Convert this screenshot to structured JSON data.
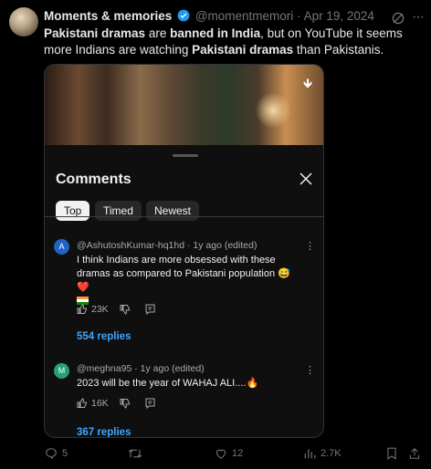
{
  "tweet": {
    "author_name": "Moments & memories",
    "handle": "@momentmemori",
    "date": "Apr 19, 2024",
    "text_parts": {
      "p1": "Pakistani dramas",
      "p2": " are ",
      "p3": "banned in India",
      "p4": ", but on YouTube it seems more Indians are watching ",
      "p5": "Pakistani dramas",
      "p6": " than Pakistanis."
    }
  },
  "media": {
    "panel_title": "Comments",
    "tabs": [
      "Top",
      "Timed",
      "Newest"
    ],
    "active_tab": "Top",
    "comments": [
      {
        "avatar_letter": "A",
        "avatar_color": "#1e63c7",
        "author": "@AshutoshKumar-hq1hd",
        "meta": "· 1y ago (edited)",
        "text": "I think Indians are more obsessed with these dramas as compared to Pakistani population 😅 ❤️",
        "likes": "23K",
        "replies": "554 replies"
      },
      {
        "avatar_letter": "M",
        "avatar_color": "#24a17a",
        "author": "@meghna95",
        "meta": "· 1y ago (edited)",
        "text": "2023 will be the year of WAHAJ ALI....🔥",
        "likes": "16K",
        "replies": "367 replies"
      }
    ]
  },
  "footer": {
    "replies": "5",
    "retweets": "",
    "likes": "12",
    "views": "2.7K"
  },
  "colors": {
    "accent_link": "#3ea6ff",
    "verified": "#1d9bf0",
    "muted": "#71767b"
  }
}
